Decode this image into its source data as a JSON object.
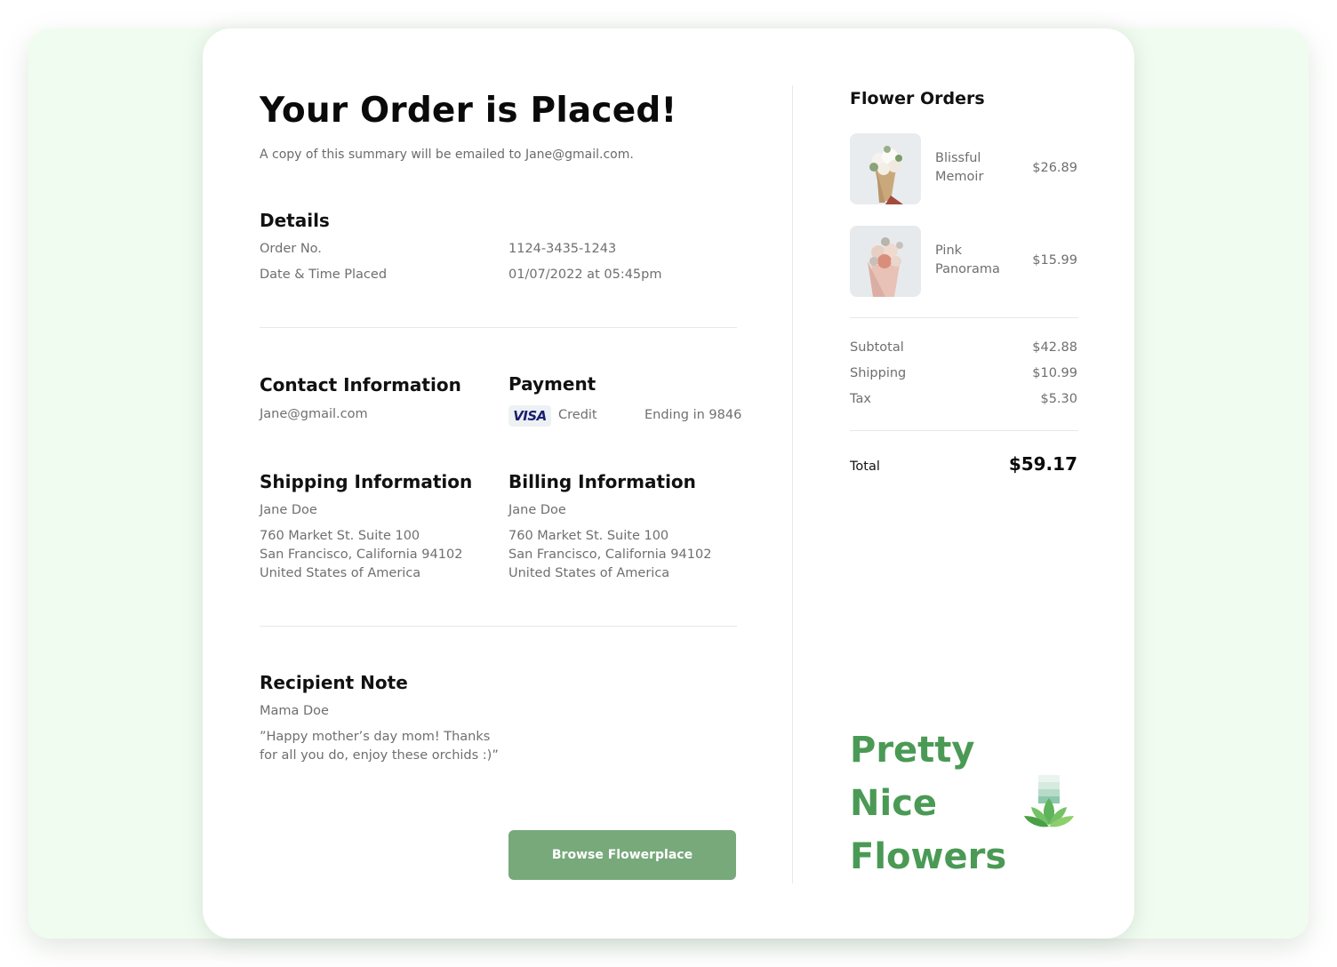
{
  "header": {
    "title": "Your Order is Placed!",
    "subtitle": "A copy of this summary will be emailed to Jane@gmail.com."
  },
  "details": {
    "heading": "Details",
    "order_label": "Order No.",
    "order_value": "1124-3435-1243",
    "date_label": "Date & Time Placed",
    "date_value": "01/07/2022 at 05:45pm"
  },
  "contact": {
    "heading": "Contact Information",
    "email": "Jane@gmail.com"
  },
  "payment": {
    "heading": "Payment",
    "card_brand": "VISA",
    "method": "Credit",
    "ending": "Ending in 9846"
  },
  "shipping": {
    "heading": "Shipping Information",
    "name": "Jane Doe",
    "line1": "760 Market St. Suite 100",
    "line2": "San Francisco, California 94102",
    "line3": "United States of America"
  },
  "billing": {
    "heading": "Billing Information",
    "name": "Jane Doe",
    "line1": "760 Market St. Suite 100",
    "line2": "San Francisco, California 94102",
    "line3": "United States of America"
  },
  "note": {
    "heading": "Recipient Note",
    "recipient": "Mama Doe",
    "line1": "”Happy mother’s day mom! Thanks",
    "line2": "for all you do, enjoy these orchids :)”"
  },
  "actions": {
    "browse_label": "Browse Flowerplace"
  },
  "orders": {
    "heading": "Flower Orders",
    "items": [
      {
        "name_line1": "Blissful",
        "name_line2": "Memoir",
        "price": "$26.89"
      },
      {
        "name_line1": "Pink",
        "name_line2": "Panorama",
        "price": "$15.99"
      }
    ]
  },
  "summary": {
    "subtotal_label": "Subtotal",
    "subtotal_value": "$42.88",
    "shipping_label": "Shipping",
    "shipping_value": "$10.99",
    "tax_label": "Tax",
    "tax_value": "$5.30",
    "total_label": "Total",
    "total_value": "$59.17"
  },
  "brand": {
    "line1": "Pretty",
    "line2": "Nice",
    "line3": "Flowers",
    "logo_icon": "lotus-icon"
  },
  "colors": {
    "accent": "#4a9a55",
    "button": "#77a97b",
    "background": "#f1fcf1"
  }
}
